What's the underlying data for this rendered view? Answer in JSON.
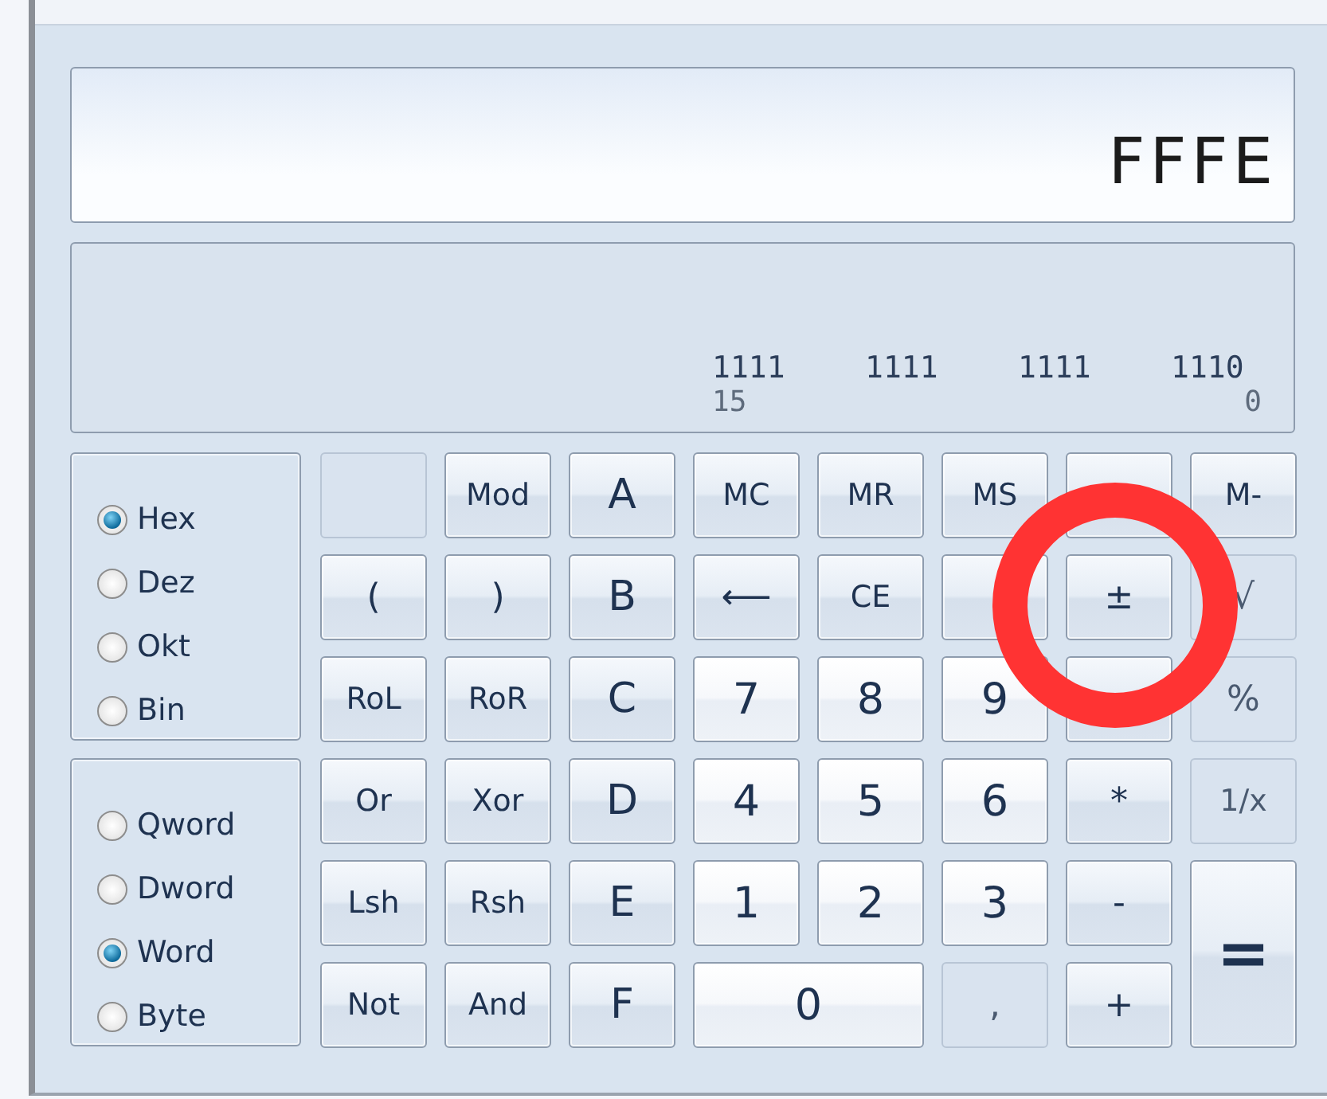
{
  "display": {
    "value": "FFFE"
  },
  "bit_panel": {
    "groups": [
      "1111",
      "1111",
      "1111",
      "1110"
    ],
    "high_index": "15",
    "low_index": "0"
  },
  "radix_options": [
    {
      "label": "Hex",
      "selected": true
    },
    {
      "label": "Dez",
      "selected": false
    },
    {
      "label": "Okt",
      "selected": false
    },
    {
      "label": "Bin",
      "selected": false
    }
  ],
  "word_size_options": [
    {
      "label": "Qword",
      "selected": false
    },
    {
      "label": "Dword",
      "selected": false
    },
    {
      "label": "Word",
      "selected": true
    },
    {
      "label": "Byte",
      "selected": false
    }
  ],
  "keys": [
    {
      "kind": "op",
      "disabled": true
    },
    {
      "label": "Mod",
      "kind": "op",
      "disabled": false
    },
    {
      "label": "A",
      "kind": "op",
      "disabled": false
    },
    {
      "label": "MC",
      "kind": "op",
      "disabled": false
    },
    {
      "label": "MR",
      "kind": "op",
      "disabled": false
    },
    {
      "label": "MS",
      "kind": "op",
      "disabled": false
    },
    {
      "kind": "op",
      "disabled": false
    },
    {
      "label": "M-",
      "kind": "op",
      "disabled": false
    },
    {
      "label": "(",
      "kind": "op",
      "disabled": false
    },
    {
      "label": ")",
      "kind": "op",
      "disabled": false
    },
    {
      "label": "B",
      "kind": "op",
      "disabled": false
    },
    {
      "label": "⟵",
      "kind": "op",
      "disabled": false
    },
    {
      "label": "CE",
      "kind": "op",
      "disabled": false
    },
    {
      "kind": "op",
      "disabled": false
    },
    {
      "label": "±",
      "kind": "op",
      "disabled": false
    },
    {
      "label": "√",
      "kind": "op",
      "disabled": true
    },
    {
      "label": "RoL",
      "kind": "op",
      "disabled": false
    },
    {
      "label": "RoR",
      "kind": "op",
      "disabled": false
    },
    {
      "label": "C",
      "kind": "op",
      "disabled": false
    },
    {
      "label": "7",
      "kind": "num",
      "disabled": false
    },
    {
      "label": "8",
      "kind": "num",
      "disabled": false
    },
    {
      "label": "9",
      "kind": "num",
      "disabled": false
    },
    {
      "kind": "op",
      "disabled": false
    },
    {
      "label": "%",
      "kind": "op",
      "disabled": true
    },
    {
      "label": "Or",
      "kind": "op",
      "disabled": false
    },
    {
      "label": "Xor",
      "kind": "op",
      "disabled": false
    },
    {
      "label": "D",
      "kind": "op",
      "disabled": false
    },
    {
      "label": "4",
      "kind": "num",
      "disabled": false
    },
    {
      "label": "5",
      "kind": "num",
      "disabled": false
    },
    {
      "label": "6",
      "kind": "num",
      "disabled": false
    },
    {
      "label": "*",
      "kind": "op",
      "disabled": false
    },
    {
      "label": "1/x",
      "kind": "op",
      "disabled": true
    },
    {
      "label": "Lsh",
      "kind": "op",
      "disabled": false
    },
    {
      "label": "Rsh",
      "kind": "op",
      "disabled": false
    },
    {
      "label": "E",
      "kind": "op",
      "disabled": false
    },
    {
      "label": "1",
      "kind": "num",
      "disabled": false
    },
    {
      "label": "2",
      "kind": "num",
      "disabled": false
    },
    {
      "label": "3",
      "kind": "num",
      "disabled": false
    },
    {
      "label": "-",
      "kind": "op",
      "disabled": false
    },
    {
      "label": "=",
      "kind": "tall",
      "disabled": false
    },
    {
      "label": "Not",
      "kind": "op",
      "disabled": false
    },
    {
      "label": "And",
      "kind": "op",
      "disabled": false
    },
    {
      "label": "F",
      "kind": "op",
      "disabled": false
    },
    {
      "label": "0",
      "kind": "wide",
      "disabled": false
    },
    {
      "label": ",",
      "kind": "op",
      "disabled": true
    },
    {
      "label": "+",
      "kind": "op",
      "disabled": false
    }
  ],
  "annotations": [
    {
      "kind": "circle",
      "color": "#ff3333"
    }
  ]
}
